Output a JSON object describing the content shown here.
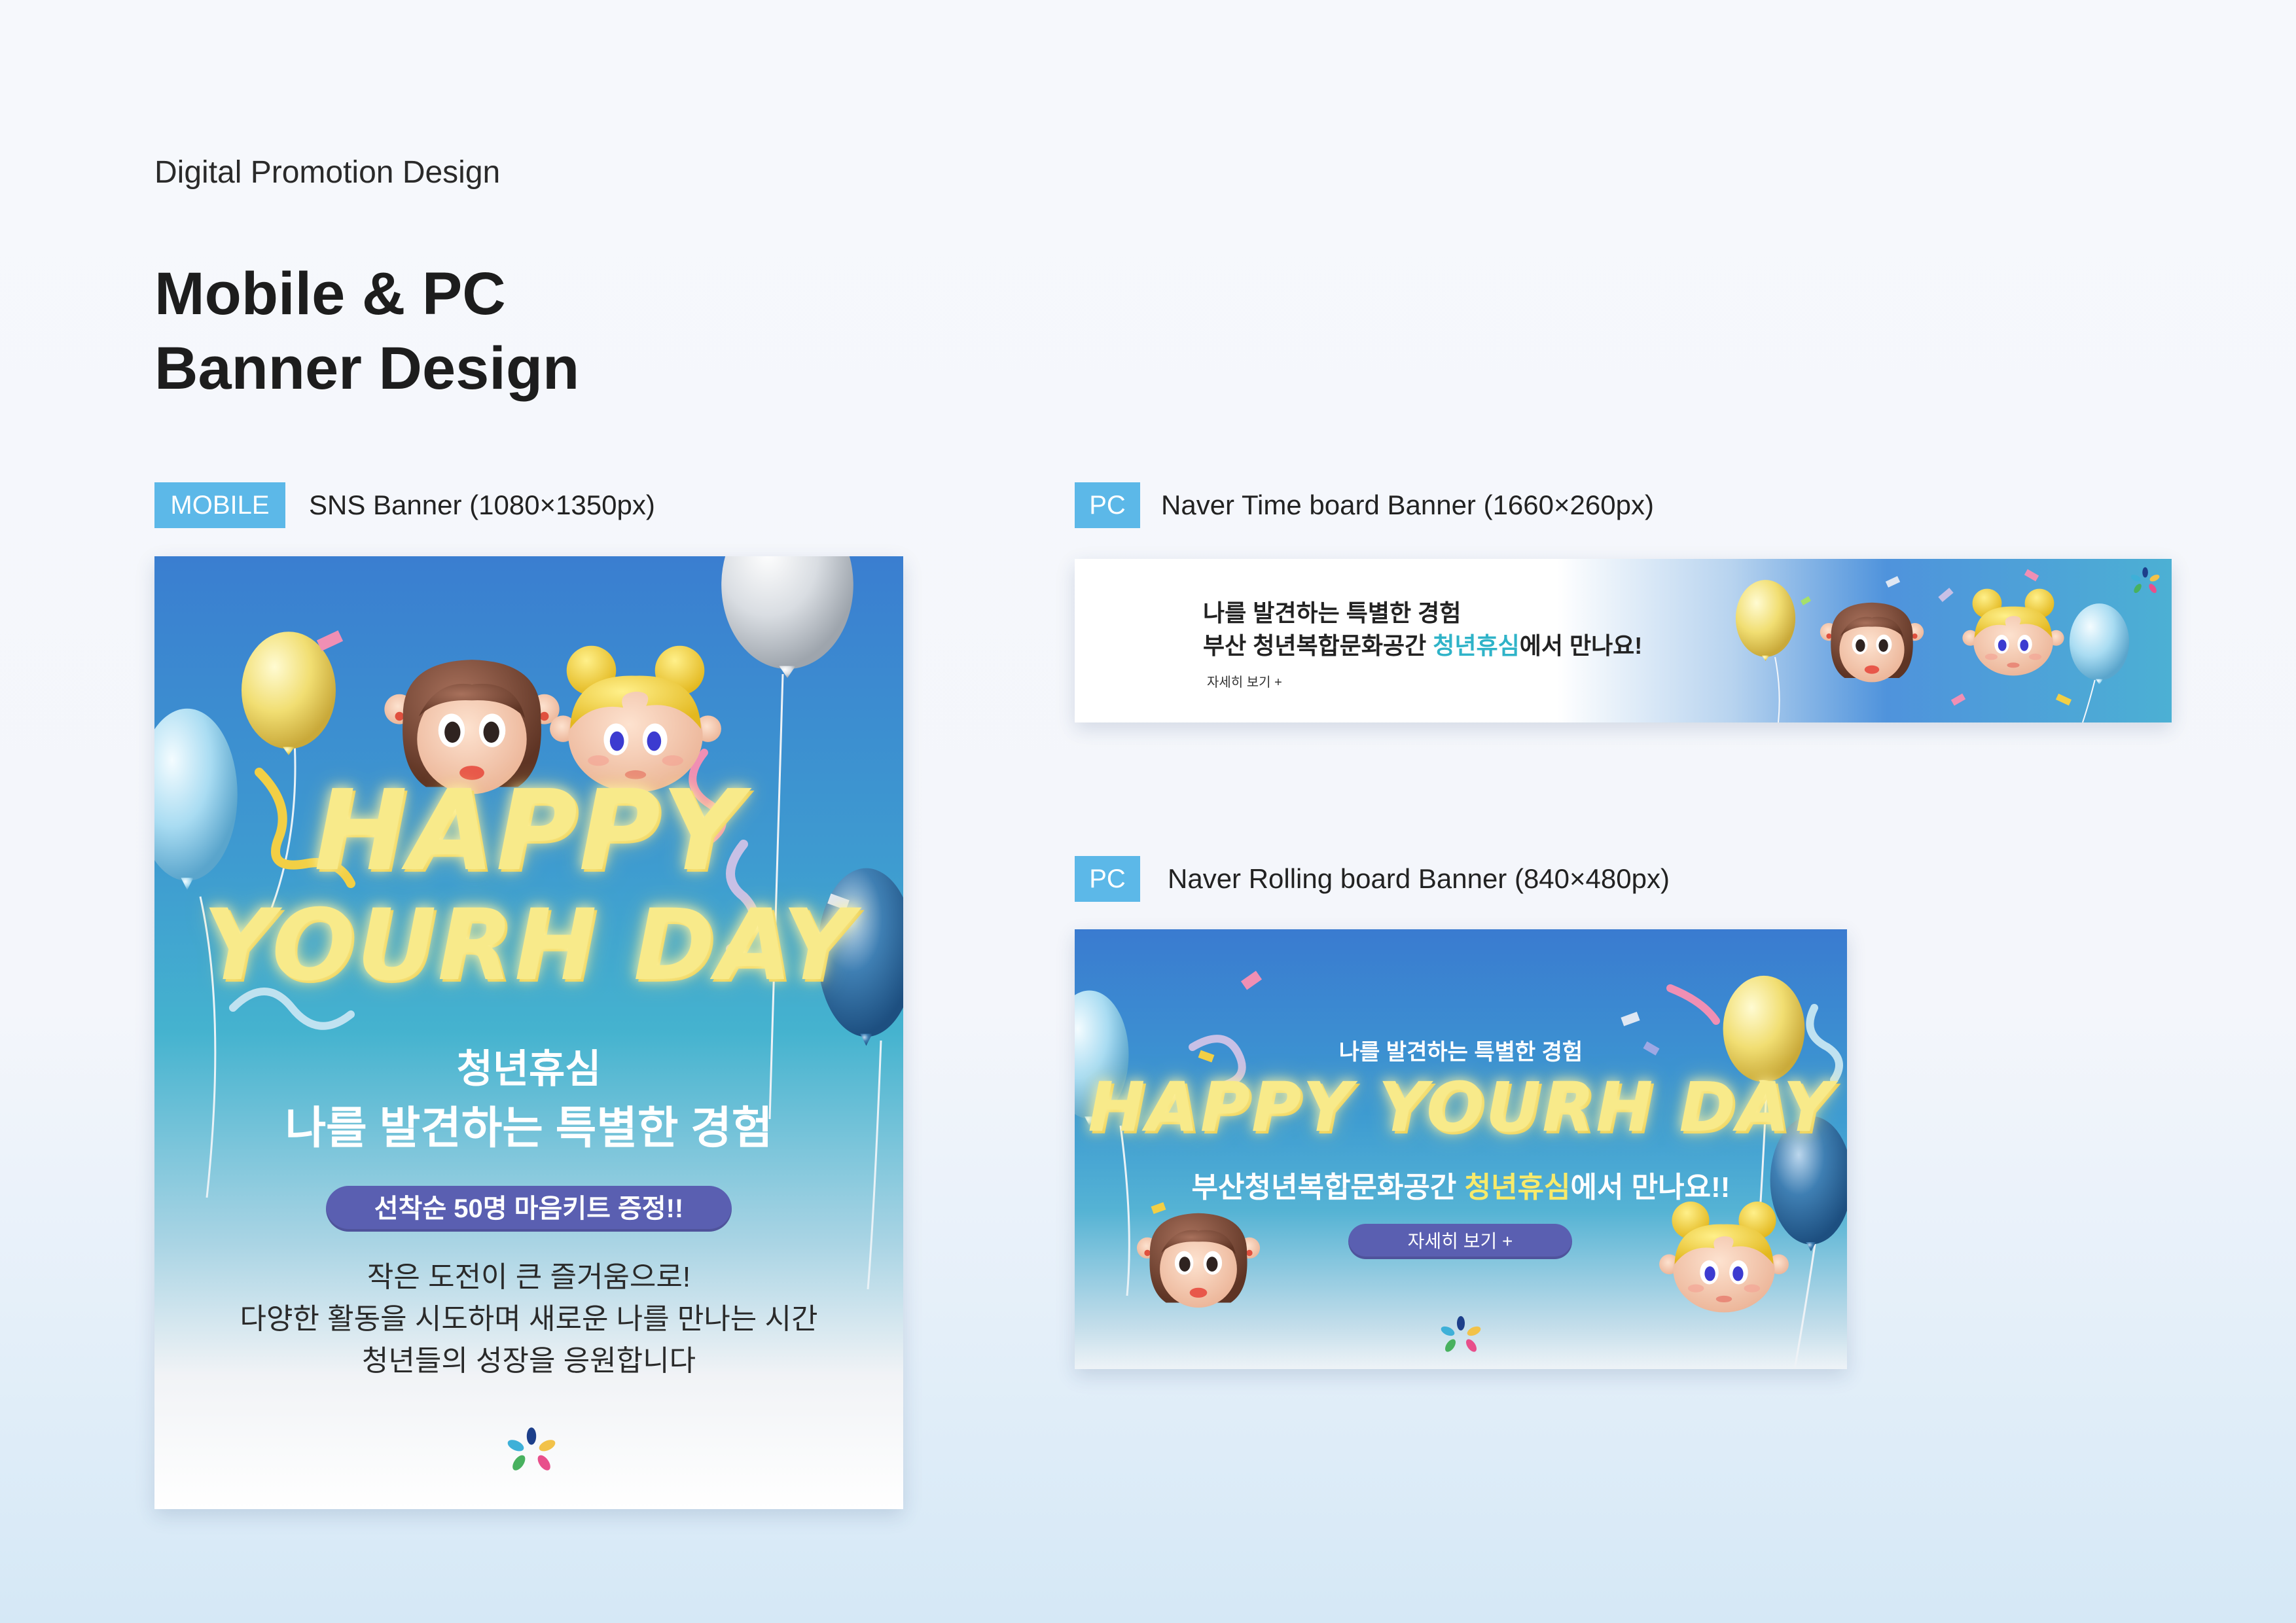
{
  "page": {
    "kicker": "Digital Promotion Design",
    "headline_line1": "Mobile & PC",
    "headline_line2": "Banner Design"
  },
  "sections": {
    "mobile": {
      "tag": "MOBILE",
      "label": "SNS Banner (1080×1350px)"
    },
    "pc_timeboard": {
      "tag": "PC",
      "label": "Naver Time board Banner (1660×260px)"
    },
    "pc_rolling": {
      "tag": "PC",
      "label": "Naver Rolling board Banner (840×480px)"
    }
  },
  "mobile_banner": {
    "happy_line1": "HAPPY",
    "happy_line2": "YOURH DAY",
    "subtitle1": "청년휴심",
    "subtitle2": "나를 발견하는 특별한 경험",
    "pill": "선착순 50명 마음키트 증정!!",
    "body1": "작은 도전이 큰 즐거움으로!",
    "body2": "다양한 활동을 시도하며 새로운 나를 만나는 시간",
    "body3": "청년들의 성장을 응원합니다"
  },
  "timeboard_banner": {
    "line1": "나를 발견하는 특별한 경험",
    "line2_before": "부산 청년복합문화공간 ",
    "line2_highlight": "청년휴심",
    "line2_after": "에서 만나요!",
    "more": "자세히 보기 +"
  },
  "rolling_banner": {
    "top": "나를 발견하는 특별한 경험",
    "happy": "HAPPY YOURH DAY",
    "line_before": "부산청년복합문화공간 ",
    "line_highlight": "청년휴심",
    "line_after": "에서 만나요!!",
    "button": "자세히 보기 +"
  },
  "colors": {
    "tag_blue": "#5cb8e8",
    "pill_purple": "#5a5fb1",
    "highlight_teal": "#2fb3c8",
    "highlight_yellow": "#f8ea6a"
  },
  "icons": [
    "balloon",
    "confetti",
    "girl-brown-hair-character",
    "girl-blonde-hair-character",
    "flower-logo"
  ]
}
